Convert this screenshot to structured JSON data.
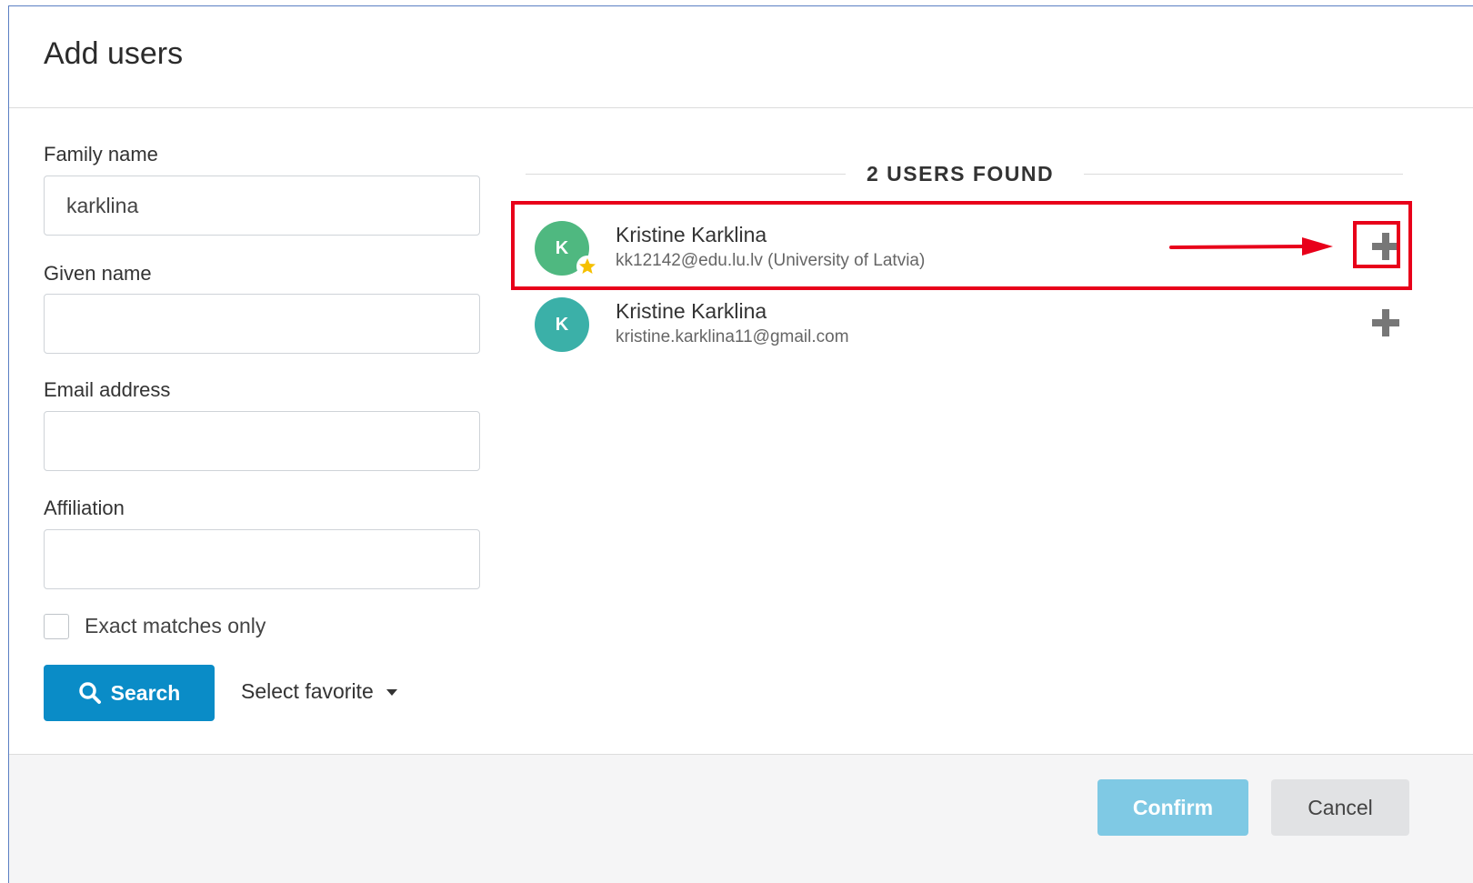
{
  "dialog": {
    "title": "Add users"
  },
  "form": {
    "family_name": {
      "label": "Family name",
      "value": "karklina"
    },
    "given_name": {
      "label": "Given name",
      "value": ""
    },
    "email": {
      "label": "Email address",
      "value": ""
    },
    "affiliation": {
      "label": "Affiliation",
      "value": ""
    },
    "exact_matches": {
      "label": "Exact matches only",
      "checked": false
    },
    "search_button": {
      "label": "Search",
      "icon": "search-icon"
    },
    "favorite_select": {
      "label": "Select favorite",
      "icon": "caret-down-icon"
    }
  },
  "results": {
    "heading": "2 USERS FOUND",
    "users": [
      {
        "initial": "K",
        "name": "Kristine Karklina",
        "email": "kk12142@edu.lu.lv (University of Latvia)",
        "avatar_color": "#4fb880",
        "favorite": true,
        "add_icon": "plus-icon",
        "highlighted": true
      },
      {
        "initial": "K",
        "name": "Kristine Karklina",
        "email": "kristine.karklina11@gmail.com",
        "avatar_color": "#3bb0a8",
        "favorite": false,
        "add_icon": "plus-icon",
        "highlighted": false
      }
    ]
  },
  "footer": {
    "confirm_label": "Confirm",
    "cancel_label": "Cancel"
  },
  "colors": {
    "primary": "#0a8cc7",
    "confirm_disabled": "#7fc9e4",
    "annotation_red": "#e8001a"
  }
}
